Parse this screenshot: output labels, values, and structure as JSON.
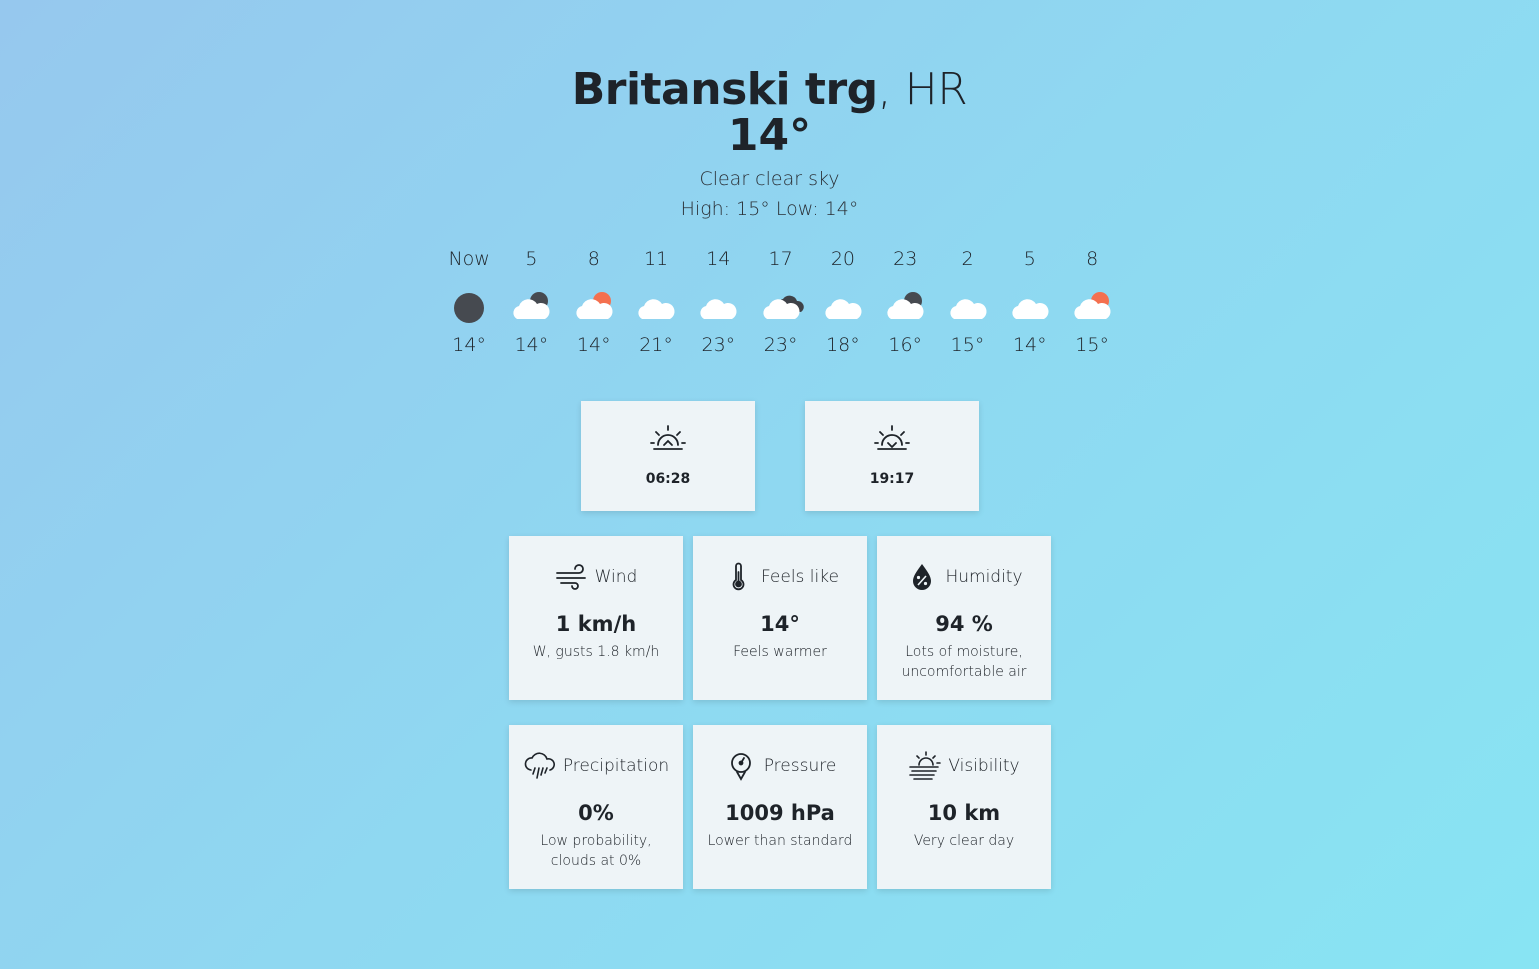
{
  "location": {
    "city": "Britanski trg",
    "country": ", HR"
  },
  "current": {
    "temperature": "14°",
    "description": "Clear clear sky",
    "high_low": "High: 15° Low: 14°"
  },
  "hourly": [
    {
      "label": "Now",
      "icon": "moon-icon",
      "temp": "14°"
    },
    {
      "label": "5",
      "icon": "cloud-moon-icon",
      "temp": "14°"
    },
    {
      "label": "8",
      "icon": "cloud-sun-icon",
      "temp": "14°"
    },
    {
      "label": "11",
      "icon": "cloud-icon",
      "temp": "21°"
    },
    {
      "label": "14",
      "icon": "cloud-icon",
      "temp": "23°"
    },
    {
      "label": "17",
      "icon": "cloud-dark-icon",
      "temp": "23°"
    },
    {
      "label": "20",
      "icon": "cloud-icon",
      "temp": "18°"
    },
    {
      "label": "23",
      "icon": "cloud-moon-icon",
      "temp": "16°"
    },
    {
      "label": "2",
      "icon": "cloud-icon",
      "temp": "15°"
    },
    {
      "label": "5",
      "icon": "cloud-icon",
      "temp": "14°"
    },
    {
      "label": "8",
      "icon": "cloud-sun-icon",
      "temp": "15°"
    }
  ],
  "sun": {
    "sunrise": "06:28",
    "sunset": "19:17"
  },
  "details": {
    "wind": {
      "title": "Wind",
      "value": "1 km/h",
      "detail": "W, gusts 1.8 km/h"
    },
    "feels_like": {
      "title": "Feels like",
      "value": "14°",
      "detail": "Feels warmer"
    },
    "humidity": {
      "title": "Humidity",
      "value": "94 %",
      "detail": "Lots of moisture, uncomfortable air"
    },
    "precipitation": {
      "title": "Precipitation",
      "value": "0%",
      "detail": "Low probability, clouds at 0%"
    },
    "pressure": {
      "title": "Pressure",
      "value": "1009 hPa",
      "detail": "Lower than standard"
    },
    "visibility": {
      "title": "Visibility",
      "value": "10 km",
      "detail": "Very clear day"
    }
  },
  "colors": {
    "moon": "#464a50",
    "sun": "#f4704f",
    "cloud": "#ffffff",
    "cloud_dark": "#3e4248"
  }
}
